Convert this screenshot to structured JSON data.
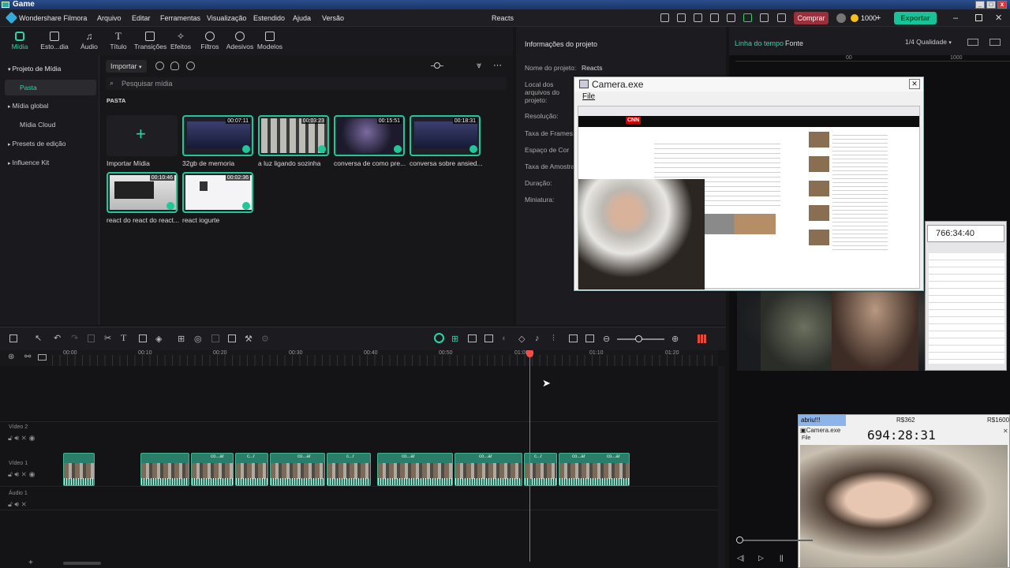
{
  "game_window": {
    "title": "Game"
  },
  "app": {
    "name": "Wondershare Filmora",
    "project_title": "Reacts"
  },
  "menu": [
    "Arquivo",
    "Editar",
    "Ferramentas",
    "Visualização",
    "Estendido",
    "Ajuda",
    "Versão"
  ],
  "topbar": {
    "buy_label": "Comprar",
    "credits": "1000",
    "export_label": "Exportar"
  },
  "toolbar": [
    {
      "label": "Mídia",
      "icon": "media-icon"
    },
    {
      "label": "Esto...dia",
      "icon": "stock-icon"
    },
    {
      "label": "Áudio",
      "icon": "audio-icon"
    },
    {
      "label": "Título",
      "icon": "title-icon"
    },
    {
      "label": "Transições",
      "icon": "transitions-icon"
    },
    {
      "label": "Efeitos",
      "icon": "effects-icon"
    },
    {
      "label": "Filtros",
      "icon": "filters-icon"
    },
    {
      "label": "Adesivos",
      "icon": "stickers-icon"
    },
    {
      "label": "Modelos",
      "icon": "templates-icon"
    }
  ],
  "sidebar": {
    "items": [
      {
        "label": "Projeto de Mídia",
        "expanded": true
      },
      {
        "label": "Pasta",
        "selected": true
      },
      {
        "label": "Mídia global"
      },
      {
        "label": "Mídia Cloud"
      },
      {
        "label": "Presets de edição"
      },
      {
        "label": "Influence Kit"
      }
    ]
  },
  "media": {
    "import_button": "Importar",
    "search_placeholder": "Pesquisar mídia",
    "folder_label": "PASTA",
    "import_tile_label": "Importar Mídia",
    "clips": [
      {
        "name": "32gb de memoria",
        "duration": "00:07:11"
      },
      {
        "name": "a luz ligando sozinha",
        "duration": "00:03:23"
      },
      {
        "name": "conversa de como pre...",
        "duration": "00:15:51"
      },
      {
        "name": "conversa sobre ansied...",
        "duration": "00:18:31"
      },
      {
        "name": "react do react do react...",
        "duration": "00:10:46"
      },
      {
        "name": "react iogurte",
        "duration": "00:02:36"
      }
    ]
  },
  "project_info": {
    "title": "Informações do projeto",
    "fields": [
      {
        "label": "Nome do projeto:",
        "value": "Reacts"
      },
      {
        "label": "Local dos arquivos do projeto:",
        "value": ""
      },
      {
        "label": "Resolução:",
        "value": ""
      },
      {
        "label": "Taxa de Frames:",
        "value": ""
      },
      {
        "label": "Espaço de Cor",
        "value": ""
      },
      {
        "label": "Taxa de Amostra:",
        "value": ""
      },
      {
        "label": "Duração:",
        "value": ""
      },
      {
        "label": "Miniatura:",
        "value": ""
      }
    ]
  },
  "preview": {
    "tab_timeline": "Linha do tempo",
    "tab_source": "Fonte",
    "quality": "1/4 Qualidade",
    "ruler": [
      "00",
      "1000"
    ]
  },
  "camera_window": {
    "title": "Camera.exe",
    "menu_file": "File",
    "news_logo": "CNN"
  },
  "overlay_timer": {
    "value": "766:34:40"
  },
  "overlay_camera2": {
    "caption": "abriu!!!",
    "money1": "R$362",
    "money2": "R$1600",
    "title": "Camera.exe",
    "menu_file": "File",
    "timer": "694:28:31"
  },
  "timeline": {
    "ruler_labels": [
      "00:00",
      "00:10",
      "00:20",
      "00:30",
      "00:40",
      "00:50",
      "01:00",
      "01:10",
      "01:20"
    ],
    "tracks": [
      {
        "label": "Vídeo 2"
      },
      {
        "label": "Vídeo 1"
      },
      {
        "label": "Áudio 1"
      }
    ],
    "clip_labels": [
      "co...ar",
      "c...r",
      "co...ar",
      "c...r",
      "co...ar",
      "c...r",
      "co...ar",
      "c...r",
      "co...ar",
      "co...ar"
    ]
  }
}
